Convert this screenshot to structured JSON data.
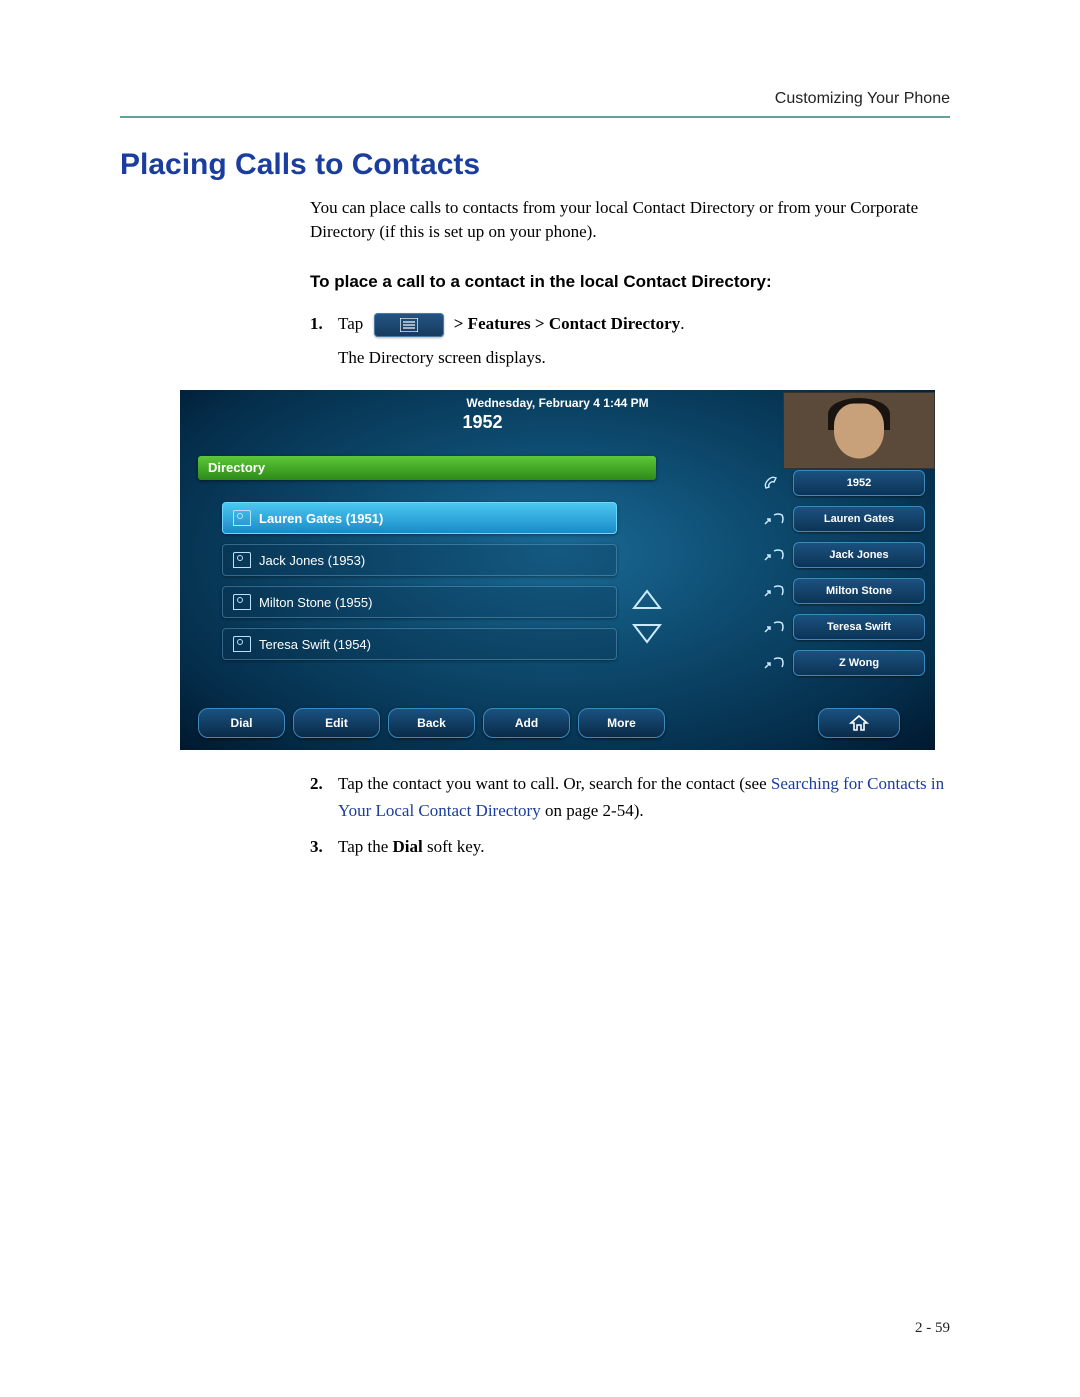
{
  "header": {
    "section": "Customizing Your Phone"
  },
  "title": "Placing Calls to Contacts",
  "intro": "You can place calls to contacts from your local Contact Directory or from your Corporate Directory (if this is set up on your phone).",
  "subheading": "To place a call to a contact in the local Contact Directory:",
  "step1": {
    "num": "1.",
    "pre": "Tap",
    "post_bold": " > Features > Contact Directory",
    "period": ".",
    "result": "The Directory screen displays."
  },
  "step2": {
    "num": "2.",
    "text_a": "Tap the contact you want to call. Or, search for the contact (see ",
    "link": "Searching for Contacts in Your Local Contact Directory",
    "text_b": " on page 2-54)."
  },
  "step3": {
    "num": "3.",
    "text_a": "Tap the ",
    "bold": "Dial",
    "text_b": " soft key."
  },
  "phone": {
    "datetime": "Wednesday, February 4  1:44 PM",
    "extension": "1952",
    "dir_label": "Directory",
    "contacts": [
      {
        "label": "Lauren Gates (1951)",
        "selected": true
      },
      {
        "label": "Jack Jones (1953)",
        "selected": false
      },
      {
        "label": "Milton Stone (1955)",
        "selected": false
      },
      {
        "label": "Teresa Swift (1954)",
        "selected": false
      }
    ],
    "speed_dials": [
      "1952",
      "Lauren Gates",
      "Jack Jones",
      "Milton Stone",
      "Teresa Swift",
      "Z Wong"
    ],
    "softkeys": [
      "Dial",
      "Edit",
      "Back",
      "Add",
      "More"
    ]
  },
  "footer": {
    "page": "2 - 59"
  }
}
